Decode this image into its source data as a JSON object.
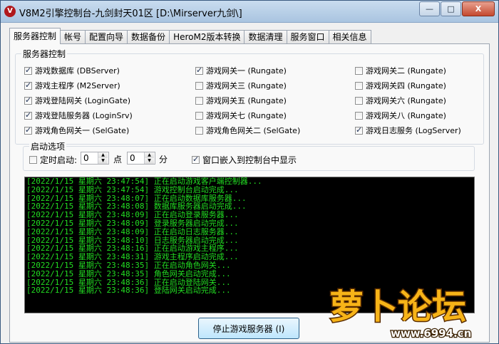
{
  "window": {
    "title": "V8M2引擎控制台-九剑封天01区 [D:\\Mirserver九剑\\]",
    "controls": {
      "minimize": "—",
      "maximize": "□",
      "close": "X"
    }
  },
  "tabs": [
    {
      "label": "服务器控制"
    },
    {
      "label": "帐号"
    },
    {
      "label": "配置向导"
    },
    {
      "label": "数据备份"
    },
    {
      "label": "HeroM2版本转换"
    },
    {
      "label": "数据清理"
    },
    {
      "label": "服务窗口"
    },
    {
      "label": "相关信息"
    }
  ],
  "server_control": {
    "group_label": "服务器控制",
    "checkboxes": [
      {
        "label": "游戏数据库 (DBServer)",
        "checked": true
      },
      {
        "label": "游戏主程序 (M2Server)",
        "checked": true
      },
      {
        "label": "游戏登陆网关 (LoginGate)",
        "checked": true
      },
      {
        "label": "游戏登陆服务器 (LoginSrv)",
        "checked": true
      },
      {
        "label": "游戏角色网关一 (SelGate)",
        "checked": true
      },
      {
        "label": "游戏网关一 (Rungate)",
        "checked": true
      },
      {
        "label": "游戏网关三 (Rungate)",
        "checked": false
      },
      {
        "label": "游戏网关五 (Rungate)",
        "checked": false
      },
      {
        "label": "游戏网关七 (Rungate)",
        "checked": false
      },
      {
        "label": "游戏角色网关二 (SelGate)",
        "checked": false
      },
      {
        "label": "游戏网关二 (Rungate)",
        "checked": false
      },
      {
        "label": "游戏网关四 (Rungate)",
        "checked": false
      },
      {
        "label": "游戏网关六 (Rungate)",
        "checked": false
      },
      {
        "label": "游戏网关八 (Rungate)",
        "checked": false
      },
      {
        "label": "游戏日志服务 (LogServer)",
        "checked": true
      }
    ]
  },
  "startup_options": {
    "group_label": "启动选项",
    "timed_start_label": "定时启动:",
    "timed_start_checked": false,
    "hour_value": "0",
    "hour_unit": "点",
    "minute_value": "0",
    "minute_unit": "分",
    "embed_label": "窗口嵌入到控制台中显示",
    "embed_checked": true
  },
  "log": [
    "[2022/1/15 星期六 23:47:54] 正在启动游戏客户端控制器...",
    "[2022/1/15 星期六 23:47:54] 游戏控制台启动完成...",
    "[2022/1/15 星期六 23:48:07] 正在启动数据库服务器...",
    "[2022/1/15 星期六 23:48:08] 数据库服务器启动完成...",
    "[2022/1/15 星期六 23:48:09] 正在启动登录服务器...",
    "[2022/1/15 星期六 23:48:09] 登录服务器启动完成...",
    "[2022/1/15 星期六 23:48:09] 正在启动日志服务器...",
    "[2022/1/15 星期六 23:48:10] 日志服务器启动完成...",
    "[2022/1/15 星期六 23:48:16] 正在启动游戏主程序...",
    "[2022/1/15 星期六 23:48:31] 游戏主程序启动完成...",
    "[2022/1/15 星期六 23:48:35] 正在启动角色网关...",
    "[2022/1/15 星期六 23:48:35] 角色网关启动完成...",
    "[2022/1/15 星期六 23:48:36] 正在启动登陆网关...",
    "[2022/1/15 星期六 23:48:36] 登陆网关启动完成..."
  ],
  "stop_button_label": "停止游戏服务器 (I)",
  "watermark": {
    "logo_text": "萝卜论坛",
    "url": "www.6994.cn"
  },
  "colors": {
    "log_text": "#22dd22",
    "console_bg": "#000000"
  }
}
